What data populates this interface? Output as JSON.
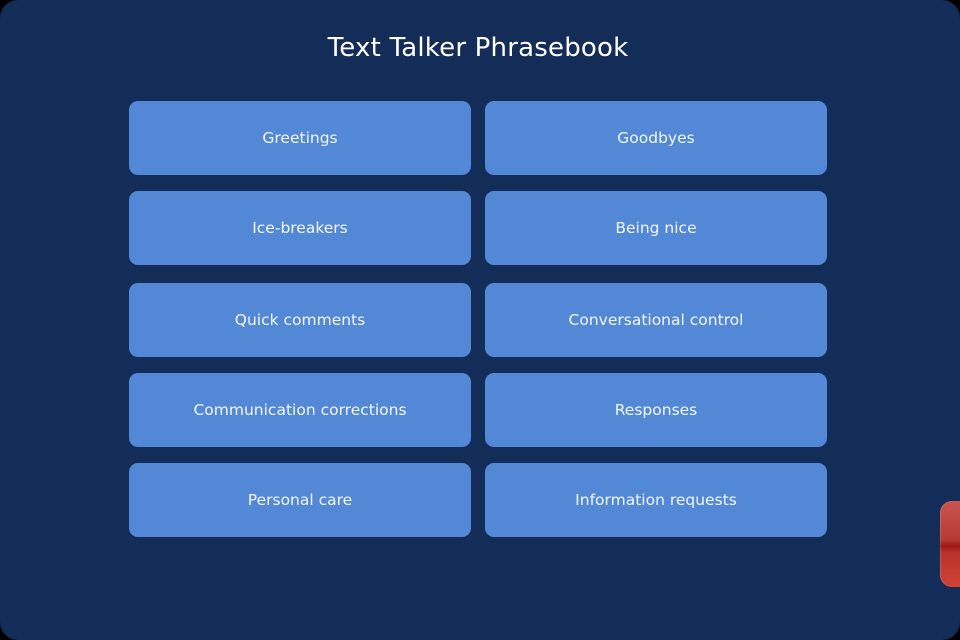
{
  "app": {
    "title": "Text Talker Phrasebook"
  },
  "categories": [
    {
      "label": "Greetings"
    },
    {
      "label": "Goodbyes"
    },
    {
      "label": "Ice-breakers"
    },
    {
      "label": "Being nice"
    },
    {
      "label": "Quick comments"
    },
    {
      "label": "Conversational control"
    },
    {
      "label": "Communication corrections"
    },
    {
      "label": "Responses"
    },
    {
      "label": "Personal care"
    },
    {
      "label": "Information requests"
    }
  ],
  "colors": {
    "background": "#142d58",
    "button": "#5288d6",
    "button_text": "#f2f6fc",
    "side_tab": "#b83a35"
  }
}
